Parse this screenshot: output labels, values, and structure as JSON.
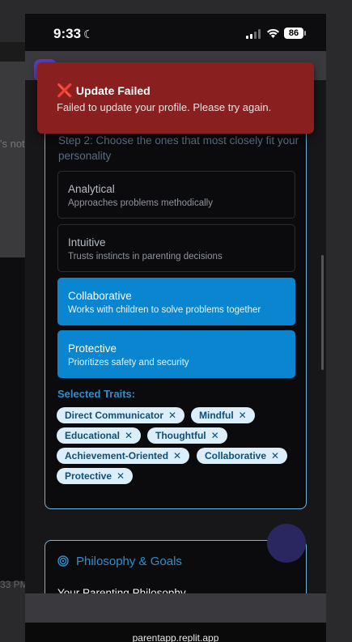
{
  "status_bar": {
    "time": "9:33",
    "moon": "☾",
    "battery": "86"
  },
  "toast": {
    "icon": "❌",
    "title": "Update Failed",
    "message": "Failed to update your profile. Please try again."
  },
  "personality": {
    "step_label": "Step 2: Choose the ones that most closely fit your personality",
    "traits": [
      {
        "title": "Analytical",
        "desc": "Approaches problems methodically",
        "selected": false
      },
      {
        "title": "Intuitive",
        "desc": "Trusts instincts in parenting decisions",
        "selected": false
      },
      {
        "title": "Collaborative",
        "desc": "Works with children to solve problems together",
        "selected": true
      },
      {
        "title": "Protective",
        "desc": "Prioritizes safety and security",
        "selected": true
      }
    ],
    "selected_label": "Selected Traits:",
    "chips": [
      "Direct Communicator",
      "Mindful",
      "Educational",
      "Thoughtful",
      "Achievement-Oriented",
      "Collaborative",
      "Protective"
    ],
    "chip_remove": "✕"
  },
  "philosophy": {
    "title": "Philosophy & Goals",
    "subtitle": "Your Parenting Philosophy"
  },
  "browser": {
    "url": "parentapp.replit.app"
  },
  "background": {
    "fragment1": "'s not",
    "fragment2": "33 PM"
  },
  "colors": {
    "accent": "#0a86d0",
    "toast": "#8a1f1f",
    "border": "#6fb7d8"
  }
}
